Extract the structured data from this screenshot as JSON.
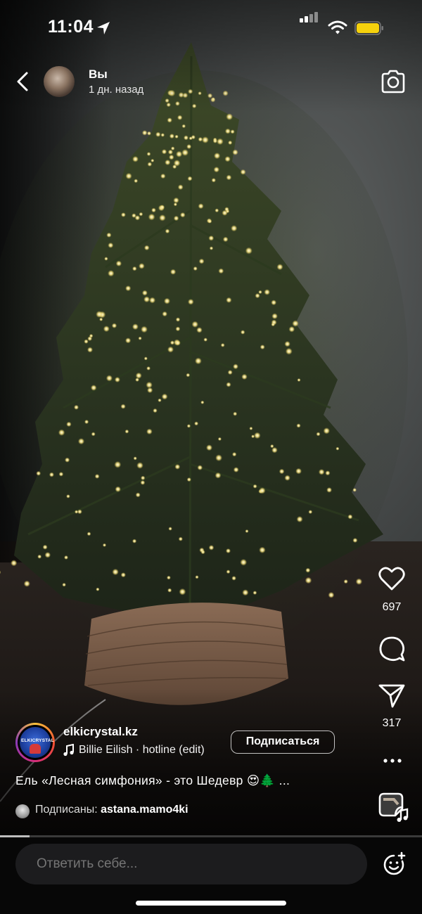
{
  "status_bar": {
    "time": "11:04",
    "battery_color": "#f5d10d"
  },
  "story_header": {
    "user_name": "Вы",
    "posted": "1 дн. назад"
  },
  "actions": {
    "likes": "697",
    "shares": "317"
  },
  "attribution": {
    "account": "elkicrystal.kz",
    "avatar_logo_text": "ELKICRYSTAL",
    "music": "Billie Eilish · hotline (edit)",
    "follow_label": "Подписаться",
    "caption": "Ель «Лесная симфония» - это Шедевр 😍🌲 ...",
    "followed_prefix": "Подписаны: ",
    "followed_by": "astana.mamo4ki"
  },
  "story_progress": 0.07,
  "reply": {
    "placeholder": "Ответить себе..."
  },
  "icons": {
    "back": "chevron-left-icon",
    "camera": "camera-icon",
    "like": "heart-icon",
    "comment": "comment-icon",
    "share": "paper-plane-icon",
    "more": "more-icon",
    "sticker": "music-sticker-icon",
    "emoji": "emoji-plus-icon"
  }
}
